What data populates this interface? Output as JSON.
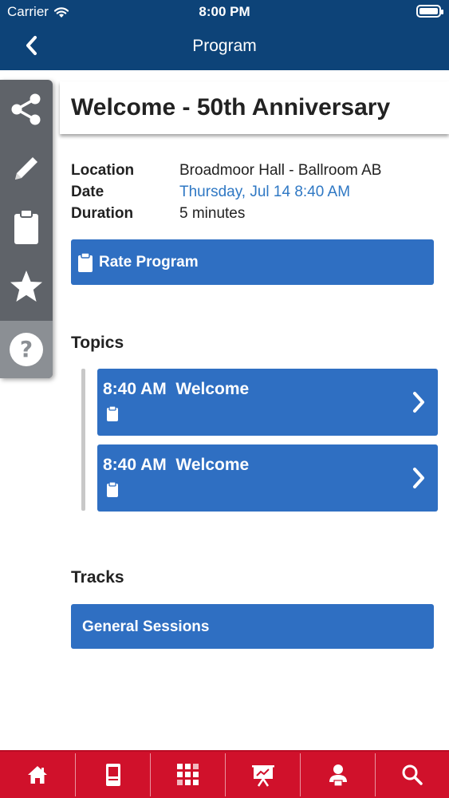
{
  "status_bar": {
    "carrier": "Carrier",
    "time": "8:00 PM"
  },
  "nav": {
    "title": "Program"
  },
  "toolbar": {
    "items": [
      {
        "icon": "share-icon"
      },
      {
        "icon": "pencil-icon"
      },
      {
        "icon": "clipboard-icon"
      },
      {
        "icon": "star-icon"
      },
      {
        "icon": "help-icon"
      }
    ]
  },
  "program": {
    "title": "Welcome - 50th Anniversary",
    "location_label": "Location",
    "location": "Broadmoor Hall - Ballroom AB",
    "date_label": "Date",
    "date": "Thursday, Jul 14 8:40 AM",
    "duration_label": "Duration",
    "duration": "5 minutes",
    "rate_label": "Rate Program"
  },
  "topics": {
    "heading": "Topics",
    "items": [
      {
        "time": "8:40 AM",
        "title": "Welcome"
      },
      {
        "time": "8:40 AM",
        "title": "Welcome"
      }
    ]
  },
  "tracks": {
    "heading": "Tracks",
    "items": [
      {
        "label": "General Sessions"
      }
    ]
  },
  "tabbar": {
    "items": [
      {
        "icon": "home-icon"
      },
      {
        "icon": "kiosk-icon"
      },
      {
        "icon": "grid-icon"
      },
      {
        "icon": "presentation-icon"
      },
      {
        "icon": "speaker-icon"
      },
      {
        "icon": "search-icon"
      }
    ]
  },
  "colors": {
    "header_bg": "#0d4378",
    "accent_blue": "#2f6fc2",
    "link_blue": "#2f78c4",
    "tabbar_red": "#d0112b",
    "toolbar_gray": "#5f6369"
  }
}
